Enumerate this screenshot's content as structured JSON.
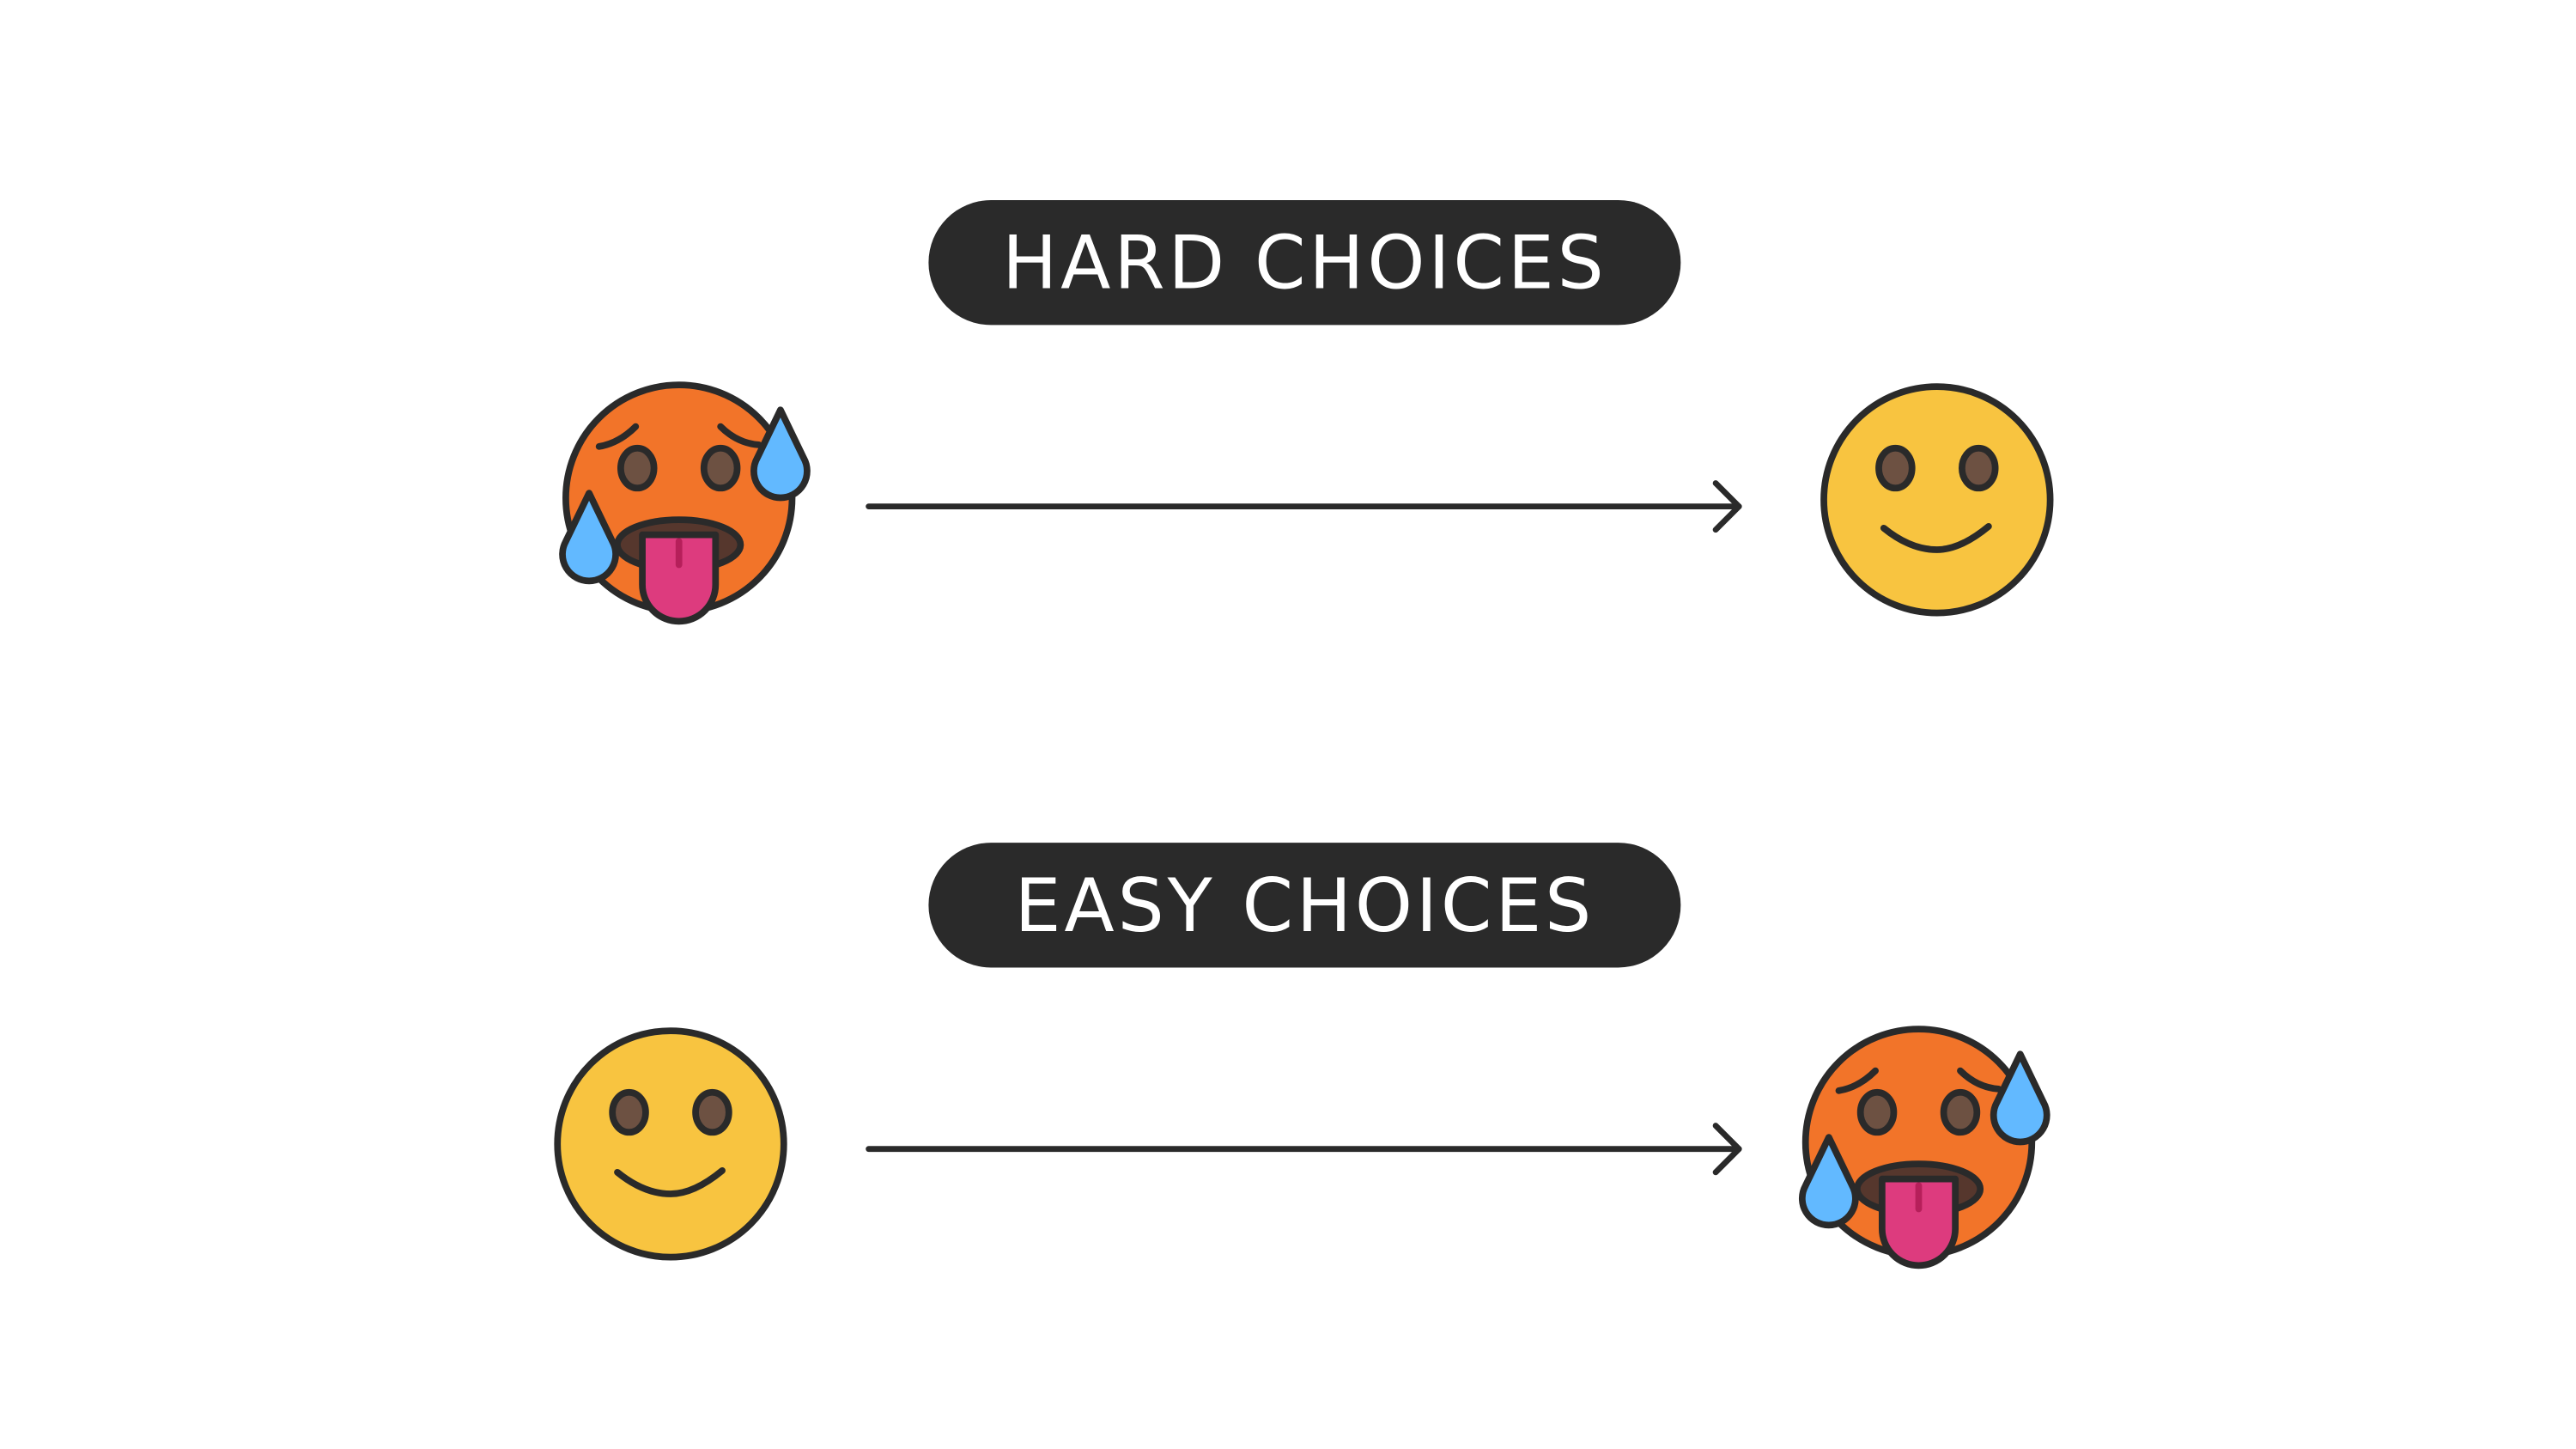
{
  "sections": [
    {
      "label": "HARD CHOICES",
      "from": "hot-sweaty-face",
      "to": "smiling-face"
    },
    {
      "label": "EASY CHOICES",
      "from": "smiling-face",
      "to": "hot-sweaty-face"
    }
  ],
  "colors": {
    "pill": "#2a2a2a",
    "outline": "#2a2a2a",
    "hot_face": "#F27429",
    "happy_face": "#F8C440",
    "eyes": "#6D5142",
    "mouth": "#56372D",
    "tongue": "#DD3B7E",
    "drop": "#62B9FF"
  }
}
